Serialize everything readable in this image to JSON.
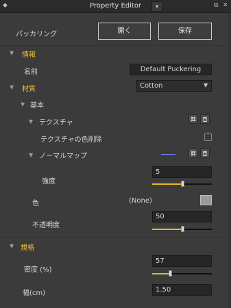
{
  "window": {
    "title": "Property Editor",
    "dropdown_arrow": "▾"
  },
  "header": {
    "name_label": "パッカリング",
    "open_button": "開く",
    "save_button": "保存"
  },
  "info": {
    "title": "情報",
    "name_label": "名前",
    "name_value": "Default Puckering"
  },
  "material": {
    "title": "材質",
    "value": "Cotton"
  },
  "basic": {
    "title": "基本",
    "texture_label": "テクスチャ",
    "texture_color_remove_label": "テクスチャの色削除",
    "normal_map_label": "ノーマルマップ",
    "intensity_label": "強度",
    "intensity_value": "5",
    "intensity_level": 0.5,
    "color_label": "色",
    "color_value": "(None)",
    "opacity_label": "不透明度",
    "opacity_value": "50",
    "opacity_level": 0.5
  },
  "spec": {
    "title": "規格",
    "density_label": "密度 (%)",
    "density_value": "57",
    "density_level": 0.3,
    "width_label": "幅(cm)",
    "width_value": "1.50"
  },
  "colors": {
    "accent": "#e8bc1c",
    "header_text": "#f0c030",
    "background": "#3b3b3b"
  },
  "icons": [
    "pin-icon",
    "dropdown-icon",
    "popout-icon",
    "close-icon",
    "grid-icon",
    "trash-icon",
    "line-preview-icon"
  ]
}
